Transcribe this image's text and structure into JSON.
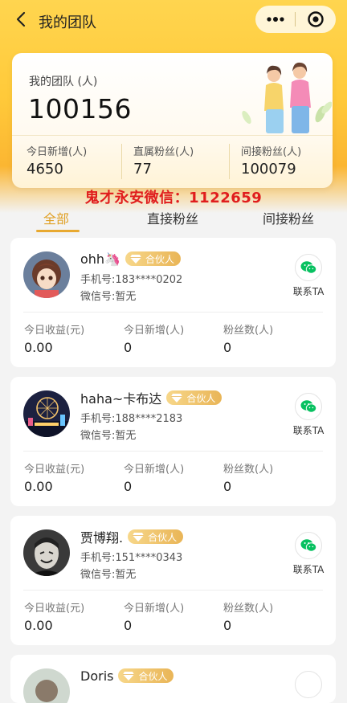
{
  "navbar": {
    "title": "我的团队"
  },
  "summary": {
    "title": "我的团队 (人)",
    "total": "100156",
    "stats": [
      {
        "label": "今日新增(人)",
        "value": "4650"
      },
      {
        "label": "直属粉丝(人)",
        "value": "77"
      },
      {
        "label": "间接粉丝(人)",
        "value": "100079"
      }
    ]
  },
  "watermark": "鬼才永安微信：1122659",
  "tabs": [
    {
      "label": "全部",
      "active": true
    },
    {
      "label": "直接粉丝",
      "active": false
    },
    {
      "label": "间接粉丝",
      "active": false
    }
  ],
  "members": [
    {
      "name": "ohh🦄",
      "badge": "合伙人",
      "phone_label": "手机号:",
      "phone": "183****0202",
      "wechat_label": "微信号:",
      "wechat": "暂无",
      "contact_label": "联系TA",
      "stats": [
        {
          "label": "今日收益(元)",
          "value": "0.00"
        },
        {
          "label": "今日新增(人)",
          "value": "0"
        },
        {
          "label": "粉丝数(人)",
          "value": "0"
        }
      ]
    },
    {
      "name": "haha~卡布达",
      "badge": "合伙人",
      "phone_label": "手机号:",
      "phone": "188****2183",
      "wechat_label": "微信号:",
      "wechat": "暂无",
      "contact_label": "联系TA",
      "stats": [
        {
          "label": "今日收益(元)",
          "value": "0.00"
        },
        {
          "label": "今日新增(人)",
          "value": "0"
        },
        {
          "label": "粉丝数(人)",
          "value": "0"
        }
      ]
    },
    {
      "name": "贾博翔.",
      "badge": "合伙人",
      "phone_label": "手机号:",
      "phone": "151****0343",
      "wechat_label": "微信号:",
      "wechat": "暂无",
      "contact_label": "联系TA",
      "stats": [
        {
          "label": "今日收益(元)",
          "value": "0.00"
        },
        {
          "label": "今日新增(人)",
          "value": "0"
        },
        {
          "label": "粉丝数(人)",
          "value": "0"
        }
      ]
    },
    {
      "name": "Doris",
      "badge": "合伙人"
    }
  ],
  "colors": {
    "accent": "#e8a930",
    "hero_yellow": "#ffca3a",
    "watermark_red": "#e01d1d",
    "wechat_green": "#07c160"
  },
  "icons": {
    "back": "chevron-left-icon",
    "more": "more-dots-icon",
    "close": "target-circle-icon",
    "badge": "diamond-icon",
    "contact": "wechat-icon"
  }
}
